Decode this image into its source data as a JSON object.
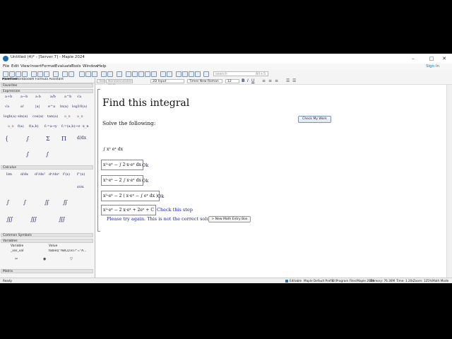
{
  "window": {
    "title": "Untitled (4)* - [Server 7] - Maple 2024",
    "controls": [
      "–",
      "□",
      "✕"
    ]
  },
  "menu": [
    "File",
    "Edit",
    "View",
    "Insert",
    "Format",
    "Evaluate",
    "Tools",
    "Window",
    "Help"
  ],
  "sign_in": "Sign In",
  "search": {
    "placeholder": "search",
    "hint": "Alt+S"
  },
  "palette_tabs": [
    "Palettes",
    "Workbook",
    "AI Formula Assistant"
  ],
  "palette_sections": {
    "favorites": "Favorites",
    "expression": "Expression",
    "calculus": "Calculus",
    "common_symbols": "Common Symbols",
    "variables": "Variables",
    "matrix": "Matrix"
  },
  "expression_palette": [
    "a+b",
    "a−b",
    "a·b",
    "a/b",
    "a^b",
    "√a",
    "√a",
    "a!",
    "|a|",
    "e^a",
    "ln(a)",
    "log10(a)",
    "logb(a)",
    "sin(a)",
    "cos(a)",
    "tan(a)",
    "a_n",
    "a_n",
    "a_n",
    "f(a)",
    "f(a,b)",
    "f:=a→y",
    "f:=(a,b)→z",
    "x_n"
  ],
  "calculus_palette": [
    "lim",
    "d/dx",
    "d²/dx²",
    "dⁿ/dxⁿ",
    "f'(x)",
    "f''(x)",
    "∂/∂x"
  ],
  "variables_table": {
    "headers": [
      "Variable",
      "Value"
    ],
    "rows": [
      [
        "_var_val",
        "table([\"ABCD.kl.r\"=\"A..."
      ]
    ]
  },
  "context_bar": {
    "text_btn": "Text",
    "math_btn": "Nonexecutable Math",
    "style": "2D Input",
    "font": "Times New Roman",
    "size": "12"
  },
  "document": {
    "heading": "Find this integral",
    "instruction": "Solve the following:",
    "check_button": "Check My Work",
    "problem": "∫ x² eˣ dx",
    "steps": [
      {
        "expr": "x²·eˣ − ∫ 2·x·eˣ dx",
        "feedback": "Ok"
      },
      {
        "expr": "x²·eˣ − 2 ∫ x·eˣ dx",
        "feedback": "Ok"
      },
      {
        "expr": "x²·eˣ − 2 ( x·eˣ − ∫ eˣ dx )",
        "feedback": "Ok"
      },
      {
        "expr": "x²·eˣ − 2 x·eˣ + 2eˣ + C",
        "feedback": "Check this step"
      }
    ],
    "message": "Please try again. This is not the correct solution",
    "new_box_button": "> New Math Entry Box"
  },
  "status": {
    "ready": "Ready",
    "editable": "Editable",
    "profile": "Maple Default Profile",
    "path": "C:\\Program Files\\Maple 2024",
    "memory": "Memory: 76.36M",
    "time": "Time: 1.20s",
    "zoom": "Zoom: 125%",
    "mode": "Math Mode"
  }
}
